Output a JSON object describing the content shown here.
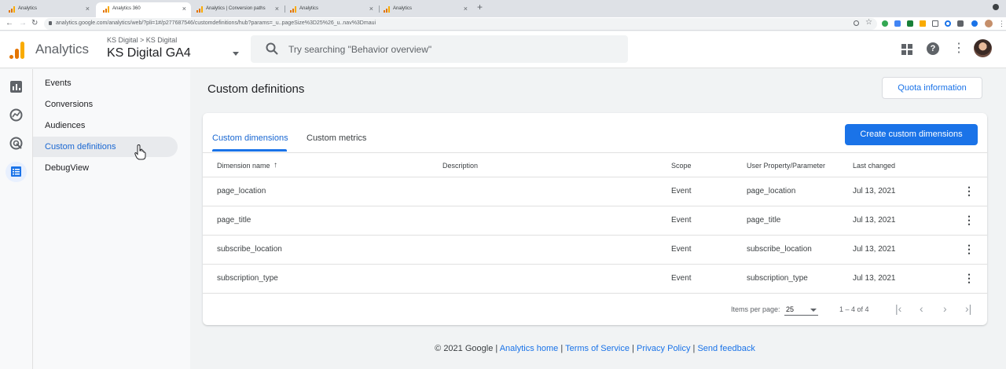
{
  "browser": {
    "tabs": [
      {
        "title": "Analytics",
        "active": false
      },
      {
        "title": "Analytics 360",
        "active": true
      },
      {
        "title": "Analytics | Conversion paths",
        "active": false
      },
      {
        "title": "Analytics",
        "active": false
      },
      {
        "title": "Analytics",
        "active": false
      }
    ],
    "new_tab": "+",
    "url": "analytics.google.com/analytics/web/?pli=1#/p277687546/customdefinitions/hub?params=_u..pageSize%3D25%26_u..nav%3Dmaui"
  },
  "header": {
    "app_name": "Analytics",
    "account_crumb": "KS Digital > KS Digital",
    "property_name": "KS Digital GA4",
    "search_placeholder": "Try searching \"Behavior overview\"",
    "help_glyph": "?"
  },
  "subnav": {
    "items": [
      {
        "label": "Events",
        "active": false
      },
      {
        "label": "Conversions",
        "active": false
      },
      {
        "label": "Audiences",
        "active": false
      },
      {
        "label": "Custom definitions",
        "active": true
      },
      {
        "label": "DebugView",
        "active": false
      }
    ]
  },
  "main": {
    "title": "Custom definitions",
    "quota_button": "Quota information",
    "tabs": [
      "Custom dimensions",
      "Custom metrics"
    ],
    "create_button": "Create custom dimensions",
    "table": {
      "headers": [
        "Dimension name",
        "Description",
        "Scope",
        "User Property/Parameter",
        "Last changed"
      ],
      "sort_glyph": "↑",
      "rows": [
        {
          "name": "page_location",
          "description": "",
          "scope": "Event",
          "param": "page_location",
          "changed": "Jul 13, 2021"
        },
        {
          "name": "page_title",
          "description": "",
          "scope": "Event",
          "param": "page_title",
          "changed": "Jul 13, 2021"
        },
        {
          "name": "subscribe_location",
          "description": "",
          "scope": "Event",
          "param": "subscribe_location",
          "changed": "Jul 13, 2021"
        },
        {
          "name": "subscription_type",
          "description": "",
          "scope": "Event",
          "param": "subscription_type",
          "changed": "Jul 13, 2021"
        }
      ]
    },
    "pagination": {
      "items_per_page_label": "Items per page:",
      "items_per_page": "25",
      "range": "1 – 4 of 4"
    }
  },
  "footer": {
    "copyright": "© 2021 Google",
    "links": [
      "Analytics home",
      "Terms of Service",
      "Privacy Policy",
      "Send feedback"
    ],
    "separator": "|"
  },
  "colors": {
    "accent": "#1a73e8",
    "active_text": "#1967d2",
    "logo_orange": "#e37400",
    "logo_yellow": "#f9ab00"
  }
}
